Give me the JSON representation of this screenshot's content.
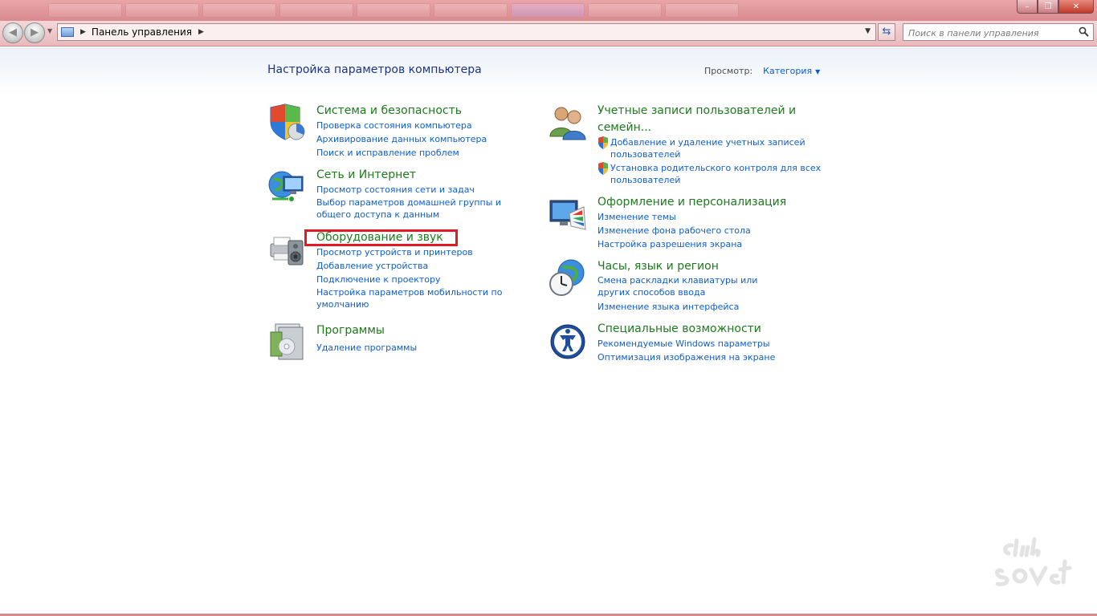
{
  "window": {
    "minimize_glyph": "–",
    "maximize_glyph": "❐",
    "close_glyph": "✕"
  },
  "address_bar": {
    "path": "Панель управления",
    "search_placeholder": "Поиск в панели управления"
  },
  "header": {
    "title": "Настройка параметров компьютера",
    "view_label": "Просмотр:",
    "view_mode": "Категория"
  },
  "left_column": [
    {
      "title": "Система и безопасность",
      "icon": "shield-pie-icon",
      "links": [
        "Проверка состояния компьютера",
        "Архивирование данных компьютера",
        "Поиск и исправление проблем"
      ]
    },
    {
      "title": "Сеть и Интернет",
      "icon": "network-globe-icon",
      "links": [
        "Просмотр состояния сети и задач",
        "Выбор параметров домашней группы и общего доступа к данным"
      ]
    },
    {
      "title": "Оборудование и звук",
      "icon": "printer-speaker-icon",
      "links": [
        "Просмотр устройств и принтеров",
        "Добавление устройства",
        "Подключение к проектору",
        "Настройка параметров мобильности по умолчанию"
      ]
    },
    {
      "title": "Программы",
      "icon": "programs-disc-icon",
      "links": [
        "Удаление программы"
      ]
    }
  ],
  "right_column": [
    {
      "title": "Учетные записи пользователей и семейн...",
      "icon": "users-icon",
      "links": [
        "Добавление и удаление учетных записей пользователей",
        "Установка родительского контроля для всех пользователей"
      ]
    },
    {
      "title": "Оформление и персонализация",
      "icon": "monitor-palette-icon",
      "links": [
        "Изменение темы",
        "Изменение фона рабочего стола",
        "Настройка разрешения экрана"
      ]
    },
    {
      "title": "Часы, язык и регион",
      "icon": "clock-globe-icon",
      "links": [
        "Смена раскладки клавиатуры или других способов ввода",
        "Изменение языка интерфейса"
      ]
    },
    {
      "title": "Специальные возможности",
      "icon": "accessibility-icon",
      "links": [
        "Рекомендуемые Windows параметры",
        "Оптимизация изображения на экране"
      ]
    }
  ],
  "colors": {
    "category_title": "#1d7a1d",
    "link": "#0f5ecd",
    "page_title": "#1e3287",
    "highlight_box": "#e11b25",
    "chrome": "#e9b9bc"
  }
}
